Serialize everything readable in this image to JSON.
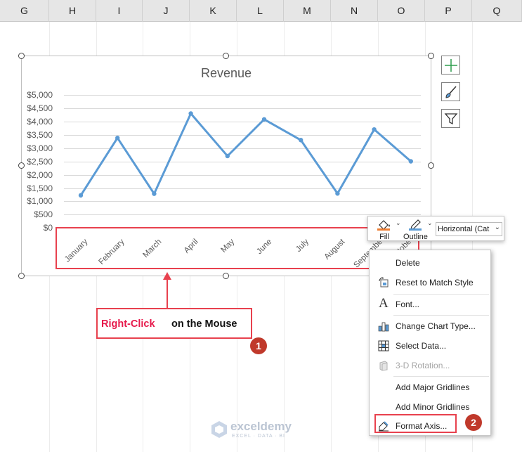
{
  "columns": [
    "G",
    "H",
    "I",
    "J",
    "K",
    "L",
    "M",
    "N",
    "O",
    "P",
    "Q"
  ],
  "chart": {
    "title": "Revenue",
    "y_ticks": [
      "$5,000",
      "$4,500",
      "$4,000",
      "$3,500",
      "$3,000",
      "$2,500",
      "$2,000",
      "$1,500",
      "$1,000",
      "$500",
      "$0"
    ]
  },
  "chart_data": {
    "type": "line",
    "title": "Revenue",
    "categories": [
      "January",
      "February",
      "March",
      "April",
      "May",
      "June",
      "July",
      "August",
      "September",
      "October"
    ],
    "visible_category_labels": [
      "January",
      "February",
      "March",
      "April",
      "May",
      "June",
      "July",
      "August",
      "Septembe",
      "tobe"
    ],
    "values": [
      1220,
      3380,
      1280,
      4300,
      2700,
      4080,
      3300,
      1290,
      3700,
      2500
    ],
    "ylim": [
      0,
      5000
    ],
    "y_ticks": [
      0,
      500,
      1000,
      1500,
      2000,
      2500,
      3000,
      3500,
      4000,
      4500,
      5000
    ],
    "grid": true,
    "line_color": "#5b9bd5"
  },
  "side_buttons": [
    "plus-icon",
    "brush-icon",
    "filter-icon"
  ],
  "mini_toolbar": {
    "fill_label": "Fill",
    "outline_label": "Outline",
    "dropdown_value": "Horizontal (Cat",
    "fill_color": "#ed7d31",
    "outline_color": "#5b9bd5"
  },
  "context_menu": {
    "items": [
      {
        "label": "Delete",
        "icon": ""
      },
      {
        "label": "Reset to Match Style",
        "icon": "reset-style-icon"
      },
      {
        "label": "Font...",
        "icon": "font-icon"
      },
      {
        "label": "Change Chart Type...",
        "icon": "chart-type-icon"
      },
      {
        "label": "Select Data...",
        "icon": "select-data-icon"
      },
      {
        "label": "3-D Rotation...",
        "icon": "rotation-3d-icon"
      },
      {
        "label": "Add Major Gridlines",
        "icon": ""
      },
      {
        "label": "Add Minor Gridlines",
        "icon": ""
      },
      {
        "label": "Format Axis...",
        "icon": "format-axis-icon"
      }
    ]
  },
  "annotation": {
    "callout_action": "Right-Click",
    "callout_rest": "on the Mouse",
    "step1": "1",
    "step2": "2",
    "highlight_color": "#e8414e",
    "action_color": "#e6194b"
  },
  "watermark": {
    "brand": "exceldemy",
    "tagline": "EXCEL · DATA · BI"
  }
}
